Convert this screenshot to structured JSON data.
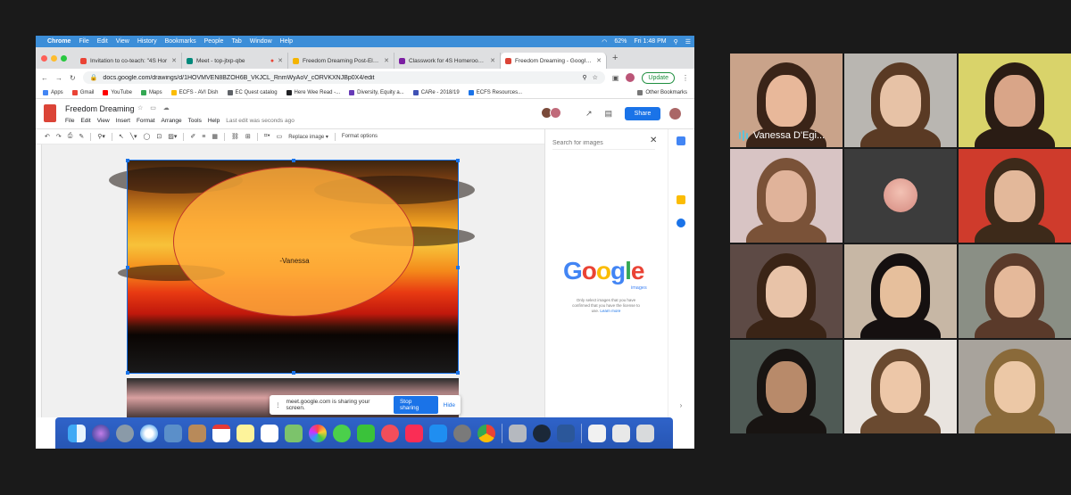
{
  "mac_menu": {
    "app": "Chrome",
    "items": [
      "File",
      "Edit",
      "View",
      "History",
      "Bookmarks",
      "People",
      "Tab",
      "Window",
      "Help"
    ],
    "battery": "62%",
    "clock": "Fri 1:48 PM"
  },
  "tabs": [
    {
      "label": "Invitation to co-teach: \"4S Hor",
      "color": "#ea4335",
      "active": false
    },
    {
      "label": "Meet - top-jtxp-qbe",
      "color": "#00897b",
      "active": false
    },
    {
      "label": "Freedom Dreaming Post-Electi",
      "color": "#f4b400",
      "active": false
    },
    {
      "label": "Classwork for 4S Homeroom 2",
      "color": "#7b1fa2",
      "active": false
    },
    {
      "label": "Freedom Dreaming - Google D",
      "color": "#db4437",
      "active": true
    }
  ],
  "address": {
    "url": "docs.google.com/drawings/d/1HOVMVEN8BZOH6B_VKJCL_RnmWyAoV_cORVKXNJBp0X4/edit",
    "update_label": "Update"
  },
  "bookmarks": [
    {
      "label": "Apps",
      "color": "#4285f4"
    },
    {
      "label": "Gmail",
      "color": "#ea4335"
    },
    {
      "label": "YouTube",
      "color": "#ff0000"
    },
    {
      "label": "Maps",
      "color": "#34a853"
    },
    {
      "label": "ECFS - AVI Dish",
      "color": "#fbbc04"
    },
    {
      "label": "EC Quest catalog",
      "color": "#5f6368"
    },
    {
      "label": "Here Wee Read -...",
      "color": "#202124"
    },
    {
      "label": "Diversity, Equity a...",
      "color": "#673ab7"
    },
    {
      "label": "CARe - 2018/19",
      "color": "#3f51b5"
    },
    {
      "label": "ECFS Resources...",
      "color": "#1a73e8"
    }
  ],
  "bookmarks_other": "Other Bookmarks",
  "doc": {
    "title": "Freedom Dreaming",
    "menu": [
      "File",
      "Edit",
      "View",
      "Insert",
      "Format",
      "Arrange",
      "Tools",
      "Help"
    ],
    "last_edit": "Last edit was seconds ago",
    "share_label": "Share"
  },
  "toolbar": {
    "replace_image": "Replace image ▾",
    "format_options": "Format options"
  },
  "canvas": {
    "ellipse_text": "-Vanessa"
  },
  "image_panel": {
    "search_placeholder": "Search for images",
    "logo_text": "Google",
    "logo_sub": "images",
    "note": "Only select images that you have confirmed that you have the license to use.",
    "learn_more": "Learn more"
  },
  "share_notice": {
    "text": "meet.google.com is sharing your screen.",
    "stop_label": "Stop sharing",
    "hide_label": "Hide"
  },
  "participants": [
    {
      "name": "Vanessa D'Egi...",
      "bg": "#c9a38a",
      "skin": "#e8b89a",
      "hair": "#3a2418"
    },
    {
      "name": "",
      "bg": "#b9b6b1",
      "skin": "#e7c2a6",
      "hair": "#5a3a24"
    },
    {
      "name": "",
      "bg": "#d9d36a",
      "skin": "#d9a588",
      "hair": "#2a1c14"
    },
    {
      "name": "",
      "bg": "#d8c4c4",
      "skin": "#e0b39a",
      "hair": "#7a5238"
    },
    {
      "name": "",
      "bg": "#3c3c3c",
      "skin": "",
      "hair": ""
    },
    {
      "name": "",
      "bg": "#cf3b2c",
      "skin": "#e3b89a",
      "hair": "#3d2a1a"
    },
    {
      "name": "",
      "bg": "#5d4a45",
      "skin": "#e8c3a8",
      "hair": "#3a2416"
    },
    {
      "name": "",
      "bg": "#c7b7a5",
      "skin": "#e6bf9c",
      "hair": "#151010"
    },
    {
      "name": "",
      "bg": "#8a8f85",
      "skin": "#e5b99a",
      "hair": "#5a3a2a"
    },
    {
      "name": "",
      "bg": "#4f5a55",
      "skin": "#b88a6a",
      "hair": "#181412"
    },
    {
      "name": "",
      "bg": "#e9e4df",
      "skin": "#edc7a8",
      "hair": "#6a4a30"
    },
    {
      "name": "",
      "bg": "#a8a39c",
      "skin": "#ecc8a6",
      "hair": "#8a6a3a"
    }
  ]
}
